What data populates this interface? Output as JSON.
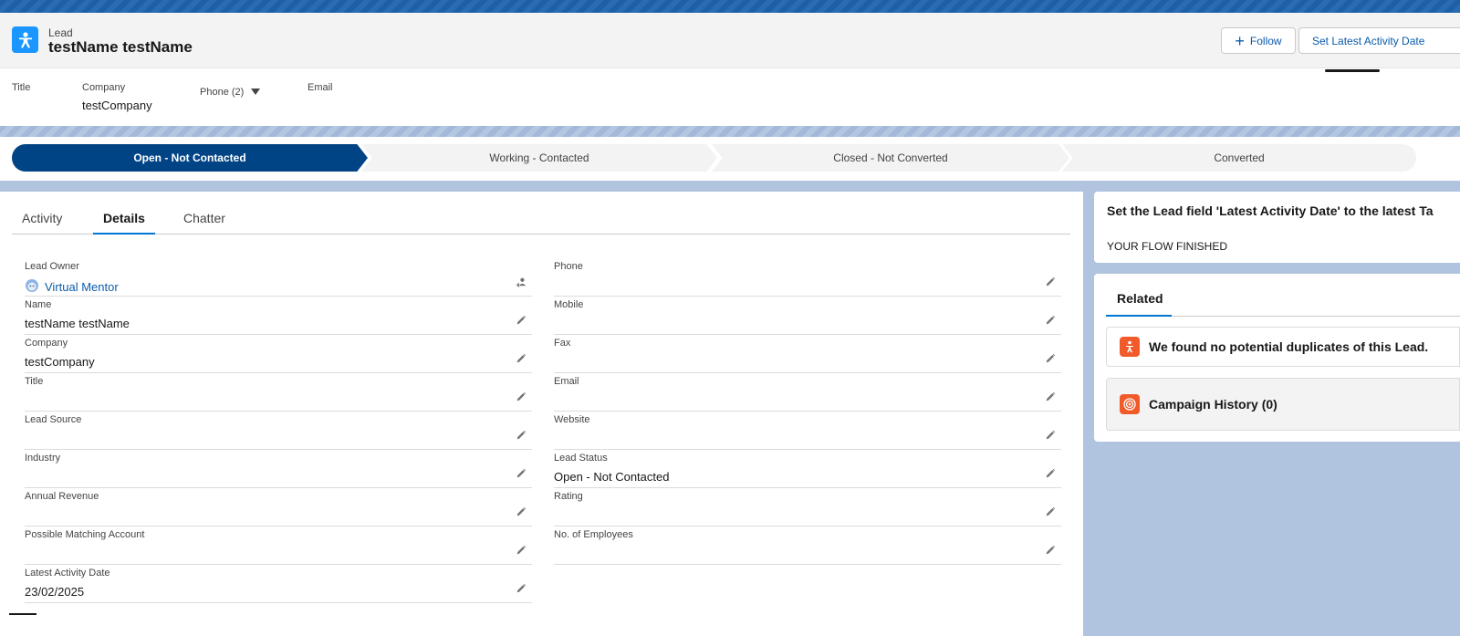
{
  "header": {
    "record_type": "Lead",
    "record_name": "testName testName",
    "follow_label": "Follow",
    "set_date_label": "Set Latest Activity Date",
    "fields": [
      {
        "label": "Title",
        "value": ""
      },
      {
        "label": "Company",
        "value": "testCompany"
      },
      {
        "label": "Phone (2)",
        "value": ""
      },
      {
        "label": "Email",
        "value": ""
      }
    ]
  },
  "path": {
    "steps": [
      "Open - Not Contacted",
      "Working - Contacted",
      "Closed - Not Converted",
      "Converted"
    ],
    "active_index": 0
  },
  "tabs": [
    "Activity",
    "Details",
    "Chatter"
  ],
  "active_tab": "Details",
  "details": {
    "left": [
      {
        "label": "Lead Owner",
        "value": "Virtual Mentor"
      },
      {
        "label": "Name",
        "value": "testName testName"
      },
      {
        "label": "Company",
        "value": "testCompany"
      },
      {
        "label": "Title",
        "value": ""
      },
      {
        "label": "Lead Source",
        "value": ""
      },
      {
        "label": "Industry",
        "value": ""
      },
      {
        "label": "Annual Revenue",
        "value": ""
      },
      {
        "label": "Possible Matching Account",
        "value": ""
      },
      {
        "label": "Latest Activity Date",
        "value": "23/02/2025"
      }
    ],
    "right": [
      {
        "label": "Phone",
        "value": ""
      },
      {
        "label": "Mobile",
        "value": ""
      },
      {
        "label": "Fax",
        "value": ""
      },
      {
        "label": "Email",
        "value": ""
      },
      {
        "label": "Website",
        "value": ""
      },
      {
        "label": "Lead Status",
        "value": "Open - Not Contacted"
      },
      {
        "label": "Rating",
        "value": ""
      },
      {
        "label": "No. of Employees",
        "value": ""
      }
    ]
  },
  "flow": {
    "title": "Set the Lead field 'Latest Activity Date' to the latest Ta",
    "status": "YOUR FLOW FINISHED"
  },
  "related": {
    "tab_label": "Related",
    "duplicates_text": "We found no potential duplicates of this Lead.",
    "campaign_history": "Campaign History (0)"
  },
  "colors": {
    "brand_blue": "#0176d3",
    "path_active": "#014486",
    "lead_icon": "#1b96ff",
    "related_icon": "#f15a29"
  }
}
